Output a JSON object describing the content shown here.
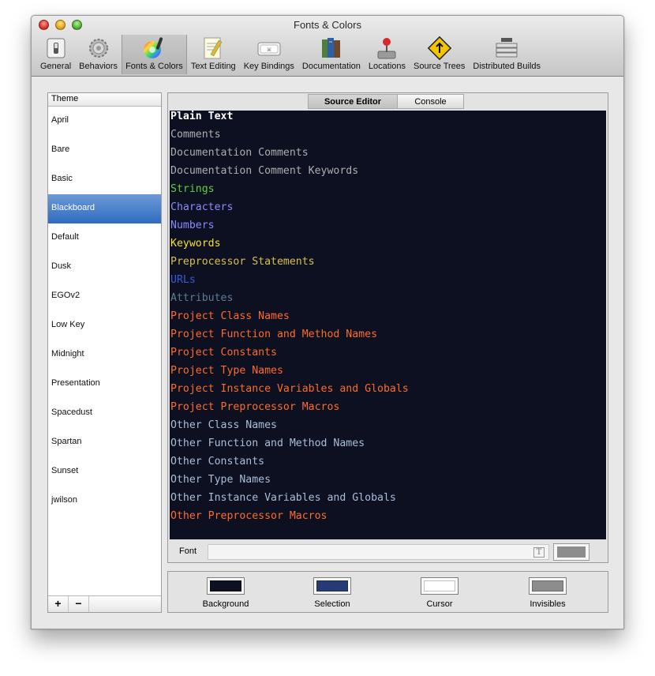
{
  "window": {
    "title": "Fonts & Colors"
  },
  "toolbar": {
    "items": [
      {
        "label": "General",
        "icon": "switch-icon"
      },
      {
        "label": "Behaviors",
        "icon": "gears-icon"
      },
      {
        "label": "Fonts & Colors",
        "icon": "color-wheel-icon",
        "selected": true
      },
      {
        "label": "Text Editing",
        "icon": "notepad-pencil-icon"
      },
      {
        "label": "Key Bindings",
        "icon": "keyboard-key-icon"
      },
      {
        "label": "Documentation",
        "icon": "books-icon"
      },
      {
        "label": "Locations",
        "icon": "joystick-icon"
      },
      {
        "label": "Source Trees",
        "icon": "warning-sign-icon"
      },
      {
        "label": "Distributed Builds",
        "icon": "server-rack-icon"
      }
    ]
  },
  "themes": {
    "header": "Theme",
    "items": [
      "April",
      "Bare",
      "Basic",
      "Blackboard",
      "Default",
      "Dusk",
      "EGOv2",
      "Low Key",
      "Midnight",
      "Presentation",
      "Spacedust",
      "Spartan",
      "Sunset",
      "jwilson"
    ],
    "selected": "Blackboard",
    "add_label": "+",
    "remove_label": "−"
  },
  "editor": {
    "tabs": [
      {
        "label": "Source Editor",
        "active": true
      },
      {
        "label": "Console",
        "active": false
      }
    ],
    "background_color": "#0c1021",
    "syntax_items": [
      {
        "label": "Plain Text",
        "color": "#ffffff",
        "bold": true
      },
      {
        "label": "Comments",
        "color": "#aeaeae"
      },
      {
        "label": "Documentation Comments",
        "color": "#aeaeae"
      },
      {
        "label": "Documentation Comment Keywords",
        "color": "#aeaeae"
      },
      {
        "label": "Strings",
        "color": "#61ce3c"
      },
      {
        "label": "Characters",
        "color": "#8b8bff"
      },
      {
        "label": "Numbers",
        "color": "#8b8bff"
      },
      {
        "label": "Keywords",
        "color": "#fbde2d"
      },
      {
        "label": "Preprocessor Statements",
        "color": "#d8c04a"
      },
      {
        "label": "URLs",
        "color": "#3a5ad6"
      },
      {
        "label": "Attributes",
        "color": "#5f7b93"
      },
      {
        "label": "Project Class Names",
        "color": "#ff6b2b"
      },
      {
        "label": "Project Function and Method Names",
        "color": "#ff6b2b"
      },
      {
        "label": "Project Constants",
        "color": "#ff6b2b"
      },
      {
        "label": "Project Type Names",
        "color": "#ff6b2b"
      },
      {
        "label": "Project Instance Variables and Globals",
        "color": "#ff6b2b"
      },
      {
        "label": "Project Preprocessor Macros",
        "color": "#ff6b2b"
      },
      {
        "label": "Other Class Names",
        "color": "#a9bed8"
      },
      {
        "label": "Other Function and Method Names",
        "color": "#a9bed8"
      },
      {
        "label": "Other Constants",
        "color": "#a9bed8"
      },
      {
        "label": "Other Type Names",
        "color": "#a9bed8"
      },
      {
        "label": "Other Instance Variables and Globals",
        "color": "#a9bed8"
      },
      {
        "label": "Other Preprocessor Macros",
        "color": "#ff6b2b"
      }
    ],
    "font_label": "Font",
    "font_value": "",
    "font_button": "T",
    "font_color": "#8d8d8d"
  },
  "colors": [
    {
      "label": "Background",
      "color": "#0c1021"
    },
    {
      "label": "Selection",
      "color": "#253b76"
    },
    {
      "label": "Cursor",
      "color": "#ffffff"
    },
    {
      "label": "Invisibles",
      "color": "#8d8d8d"
    }
  ]
}
